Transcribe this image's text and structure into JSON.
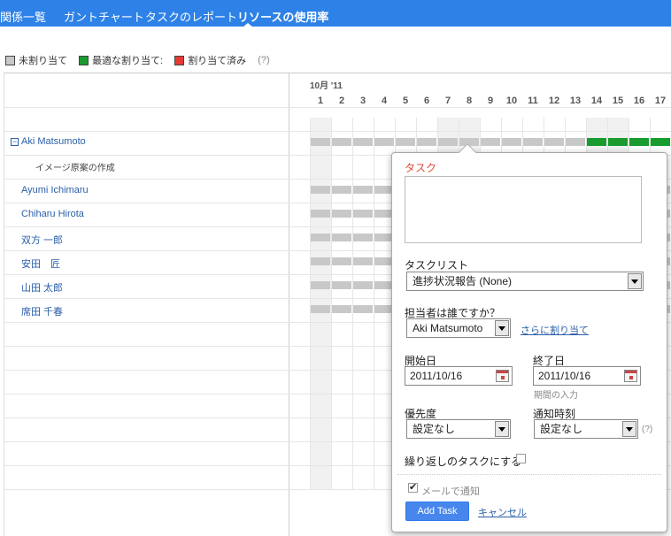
{
  "nav": {
    "tabs": [
      {
        "label": "関係一覧"
      },
      {
        "label": "ガントチャート"
      },
      {
        "label": "タスクのレポート"
      },
      {
        "label": "リソースの使用率"
      }
    ]
  },
  "legend": {
    "items": [
      {
        "label": "未割り当て",
        "color": "#c8c8c8"
      },
      {
        "label": "最適な割り当て:",
        "color": "#1a9b2e"
      },
      {
        "label": "割り当て済み",
        "color": "#e53935"
      }
    ],
    "help": "(?)"
  },
  "timeline": {
    "month": "10月 '11",
    "days": [
      "1",
      "2",
      "3",
      "4",
      "5",
      "6",
      "7",
      "8",
      "9",
      "10",
      "11",
      "12",
      "13",
      "14",
      "15",
      "16",
      "17"
    ]
  },
  "people": [
    {
      "name": "Aki Matsumoto",
      "expander": "−",
      "subtask": "イメージ原案の作成"
    },
    {
      "name": "Ayumi Ichimaru"
    },
    {
      "name": "Chiharu Hirota"
    },
    {
      "name": "双方 一郎"
    },
    {
      "name": "安田　匠"
    },
    {
      "name": "山田 太郎"
    },
    {
      "name": "席田 千春"
    }
  ],
  "colors": {
    "unassigned": "#c8c8c8",
    "optimal": "#1a9b2e",
    "nav": "#2e82e7",
    "weekend": "#eeeeee"
  },
  "popup": {
    "task_label": "タスク",
    "task_value": "",
    "tasklist_label": "タスクリスト",
    "tasklist_value": "進捗状況報告 (None)",
    "assignee_label": "担当者は誰ですか？",
    "assignee_value": "Aki Matsumoto",
    "assign_more": "さらに割り当て",
    "start_label": "開始日",
    "start_value": "2011/10/16",
    "end_label": "終了日",
    "end_value": "2011/10/16",
    "period_hint": "期間の入力",
    "priority_label": "優先度",
    "priority_value": "設定なし",
    "reminder_label": "通知時刻",
    "reminder_value": "設定なし",
    "reminder_help": "(?)",
    "repeat_label": "繰り返しのタスクにする",
    "email_notify_label": "メールで通知",
    "add_button": "Add Task",
    "cancel_link": "キャンセル"
  }
}
